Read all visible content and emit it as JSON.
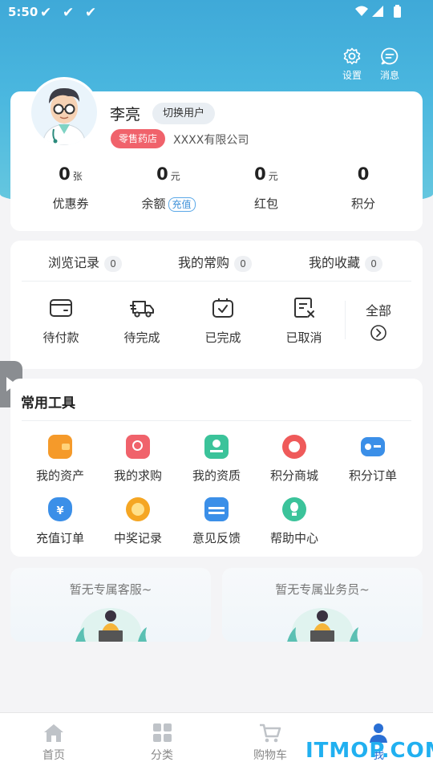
{
  "status_bar": {
    "time": "5:50"
  },
  "header": {
    "settings_label": "设置",
    "messages_label": "消息"
  },
  "profile": {
    "name": "李亮",
    "switch_user": "切换用户",
    "store_type": "零售药店",
    "company": "XXXX有限公司"
  },
  "stats": [
    {
      "value": "0",
      "unit": "张",
      "label": "优惠券"
    },
    {
      "value": "0",
      "unit": "元",
      "label": "余额",
      "action": "充值"
    },
    {
      "value": "0",
      "unit": "元",
      "label": "红包"
    },
    {
      "value": "0",
      "unit": "",
      "label": "积分"
    }
  ],
  "history": [
    {
      "label": "浏览记录",
      "count": "0"
    },
    {
      "label": "我的常购",
      "count": "0"
    },
    {
      "label": "我的收藏",
      "count": "0"
    }
  ],
  "orders": [
    {
      "label": "待付款",
      "icon": "wallet-icon"
    },
    {
      "label": "待完成",
      "icon": "truck-icon"
    },
    {
      "label": "已完成",
      "icon": "box-check-icon"
    },
    {
      "label": "已取消",
      "icon": "doc-cancel-icon"
    },
    {
      "label": "全部",
      "icon": "chevron-right-icon"
    }
  ],
  "tools": {
    "title": "常用工具",
    "items": [
      {
        "label": "我的资产",
        "icon": "wallet-icon",
        "color": "#f59a2a"
      },
      {
        "label": "我的求购",
        "icon": "search-bag-icon",
        "color": "#f0626b"
      },
      {
        "label": "我的资质",
        "icon": "certificate-icon",
        "color": "#3bc39a"
      },
      {
        "label": "积分商城",
        "icon": "medal-icon",
        "color": "#ef5a5a"
      },
      {
        "label": "积分订单",
        "icon": "card-icon",
        "color": "#3b8fe8"
      },
      {
        "label": "充值订单",
        "icon": "money-bag-icon",
        "color": "#3b8fe8"
      },
      {
        "label": "中奖记录",
        "icon": "prize-icon",
        "color": "#f5a623"
      },
      {
        "label": "意见反馈",
        "icon": "feedback-icon",
        "color": "#3b8fe8"
      },
      {
        "label": "帮助中心",
        "icon": "lightbulb-icon",
        "color": "#3bc39a"
      }
    ]
  },
  "service": {
    "customer_service": "暂无专属客服~",
    "salesperson": "暂无专属业务员~"
  },
  "tabbar": [
    {
      "label": "首页",
      "icon": "home-icon"
    },
    {
      "label": "分类",
      "icon": "grid-icon"
    },
    {
      "label": "购物车",
      "icon": "cart-icon"
    },
    {
      "label": "我",
      "icon": "user-icon",
      "active": true
    }
  ],
  "watermark": "ITMOP.COM"
}
